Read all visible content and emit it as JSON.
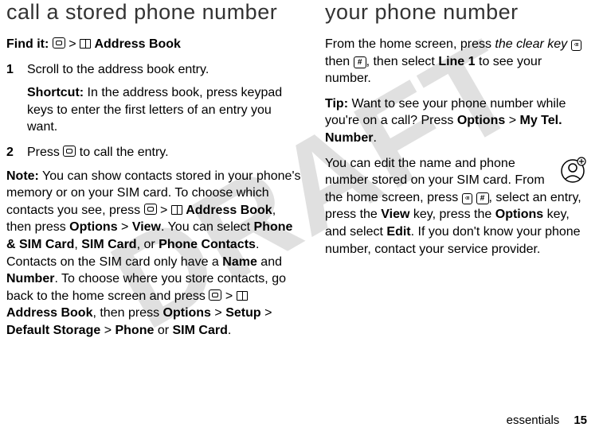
{
  "watermark": "DRAFT",
  "left": {
    "heading": "call a stored phone number",
    "findIt": {
      "label": "Find it:",
      "gt": ">",
      "menu": "Address Book"
    },
    "step1": {
      "num": "1",
      "text": "Scroll to the address book entry."
    },
    "shortcut": {
      "label": "Shortcut:",
      "text": " In the address book, press keypad keys to enter the first letters of an entry you want."
    },
    "step2": {
      "num": "2",
      "pre": "Press ",
      "post": " to call the entry."
    },
    "note": {
      "label": "Note:",
      "p1a": " You can show contacts stored in your phone's memory or on your SIM card. To choose which contacts you see, press ",
      "gt1": " > ",
      "ab": "Address Book",
      "p1b": ", then press ",
      "options": "Options",
      "gt2": " > ",
      "view": "View",
      "p1c": ". You can select ",
      "phoneSim": "Phone & SIM Card",
      "comma1": ", ",
      "sim": "SIM Card",
      "or": ", or ",
      "phoneContacts": "Phone Contacts",
      "p2a": ". Contacts on the SIM card only have a ",
      "name": "Name",
      "and": " and ",
      "number": "Number",
      "p2b": ". To choose where you store contacts, go back to the home screen and press ",
      "gt3": " > ",
      "ab2": "Address Book",
      "p2c": ", then press ",
      "options2": "Options",
      "gt4": " > ",
      "setup": "Setup",
      "gt5": " > ",
      "defStorage": "Default Storage",
      "gt6": " > ",
      "phone": "Phone",
      "or2": " or ",
      "simCard": "SIM Card",
      "period": "."
    }
  },
  "right": {
    "heading": "your phone number",
    "p1a": "From the home screen, press ",
    "clearKey": "the clear key",
    "then": " then ",
    "hashKey": "#",
    "p1b": ", then select ",
    "line1": "Line 1",
    "p1c": " to see your number.",
    "tip": {
      "label": "Tip:",
      "text": " Want to see your phone number while you're on a call? Press ",
      "options": "Options",
      "gt": " > ",
      "myTel": "My Tel. Number",
      "period": "."
    },
    "p3a": "You can edit the name and phone number stored on your SIM card. From the home screen, press ",
    "hashKey2": "#",
    "p3b": ", select an entry, press the ",
    "viewKey": "View",
    "p3c": " key, press the ",
    "optionsKey": "Options",
    "p3d": " key, and select ",
    "edit": "Edit",
    "p3e": ". If you don't know your phone number, contact your service provider."
  },
  "footer": {
    "section": "essentials",
    "page": "15"
  }
}
